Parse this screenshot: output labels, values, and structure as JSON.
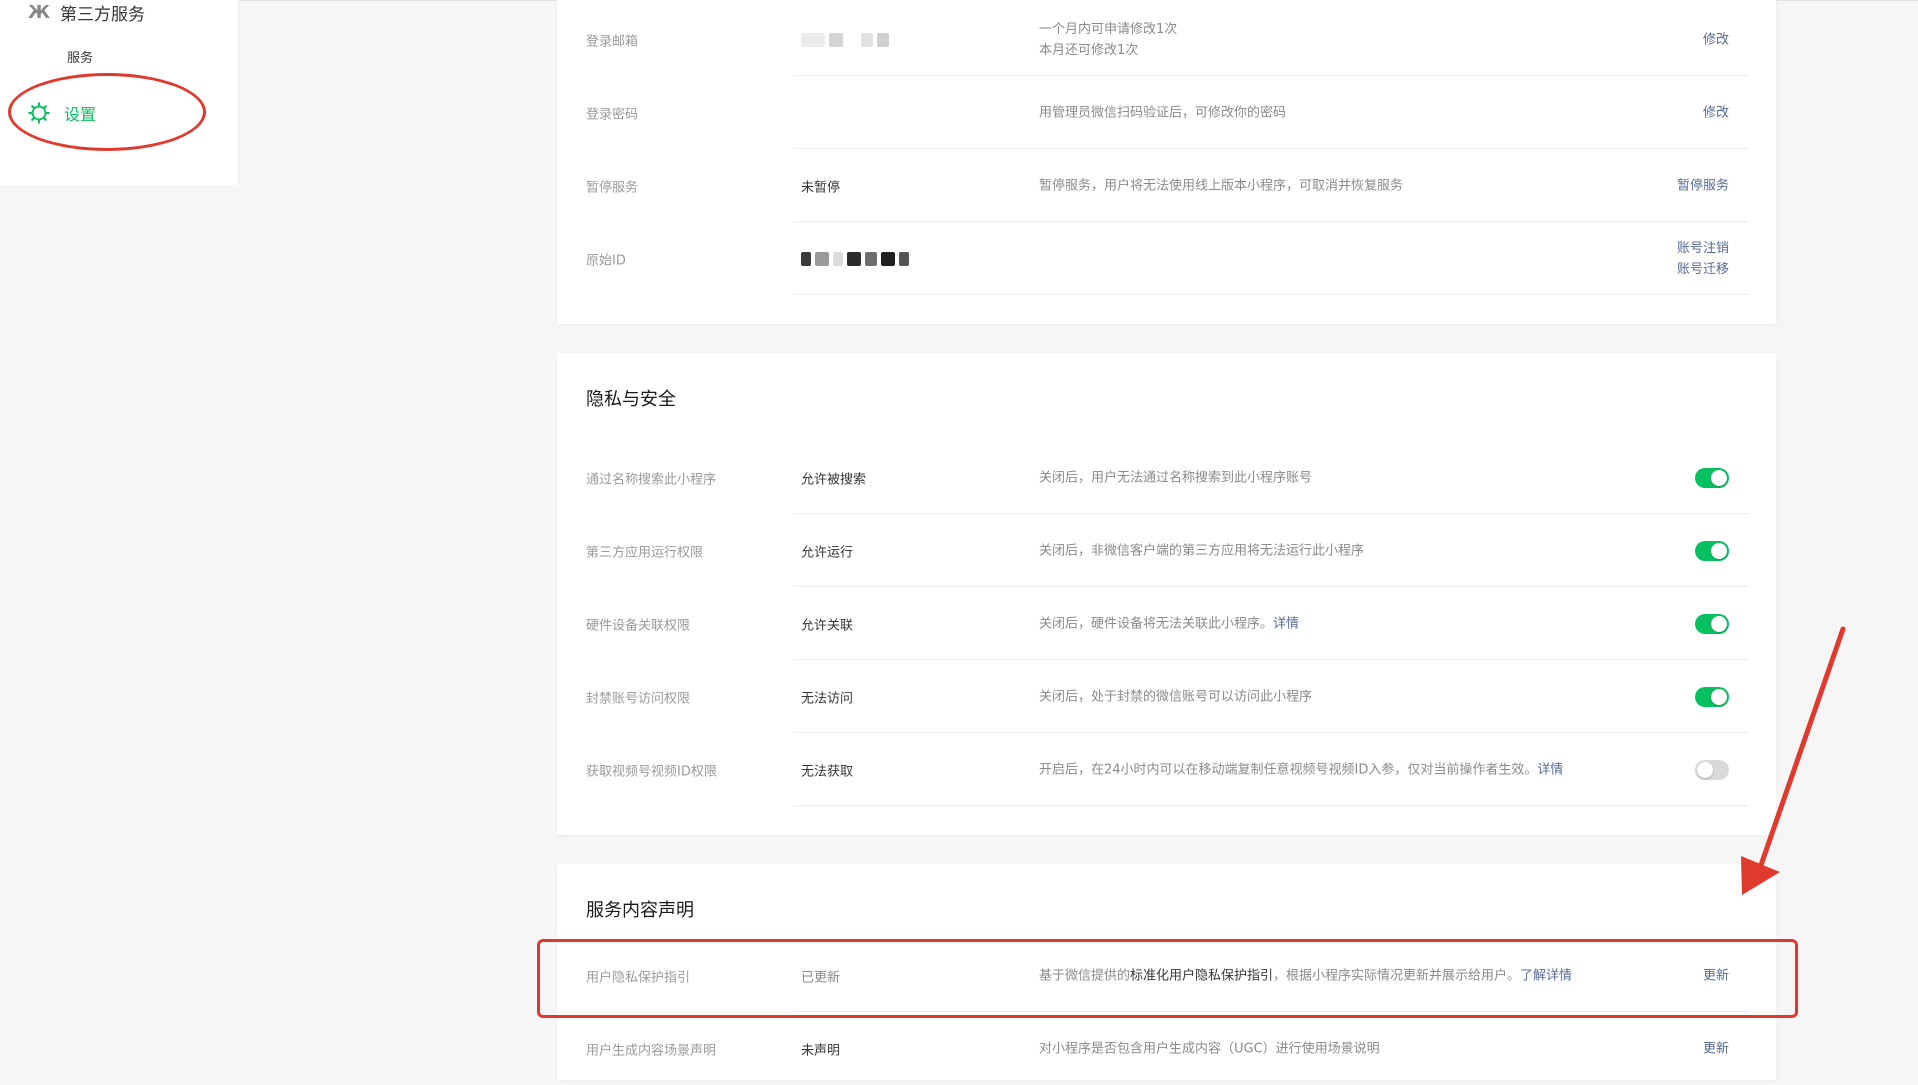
{
  "sidebar": {
    "group_label": "第三方服务",
    "sub_item": "服务",
    "settings_label": "设置"
  },
  "account": {
    "rows": [
      {
        "label": "登录邮箱",
        "value": "",
        "desc": [
          "一个月内可申请修改1次",
          "本月还可修改1次"
        ],
        "actions": [
          "修改"
        ]
      },
      {
        "label": "登录密码",
        "value": "",
        "desc": [
          "用管理员微信扫码验证后，可修改你的密码"
        ],
        "actions": [
          "修改"
        ]
      },
      {
        "label": "暂停服务",
        "value": "未暂停",
        "desc": [
          "暂停服务，用户将无法使用线上版本小程序，可取消并恢复服务"
        ],
        "actions": [
          "暂停服务"
        ]
      },
      {
        "label": "原始ID",
        "value": "",
        "desc": [],
        "actions": [
          "账号注销",
          "账号迁移"
        ]
      }
    ]
  },
  "privacy": {
    "title": "隐私与安全",
    "rows": [
      {
        "label": "通过名称搜索此小程序",
        "value": "允许被搜索",
        "desc": "关闭后，用户无法通过名称搜索到此小程序账号",
        "link": "",
        "enabled": true
      },
      {
        "label": "第三方应用运行权限",
        "value": "允许运行",
        "desc": "关闭后，非微信客户端的第三方应用将无法运行此小程序",
        "link": "",
        "enabled": true
      },
      {
        "label": "硬件设备关联权限",
        "value": "允许关联",
        "desc": "关闭后，硬件设备将无法关联此小程序。",
        "link": "详情",
        "enabled": true
      },
      {
        "label": "封禁账号访问权限",
        "value": "无法访问",
        "desc": "关闭后，处于封禁的微信账号可以访问此小程序",
        "link": "",
        "enabled": true
      },
      {
        "label": "获取视频号视频ID权限",
        "value": "无法获取",
        "desc": "开启后，在24小时内可以在移动端复制任意视频号视频ID入参，仅对当前操作者生效。",
        "link": "详情",
        "enabled": false
      }
    ]
  },
  "service_content": {
    "title": "服务内容声明",
    "rows": [
      {
        "label": "用户隐私保护指引",
        "value": "已更新",
        "desc_pre": "基于微信提供的",
        "desc_em": "标准化用户隐私保护指引",
        "desc_post": "，根据小程序实际情况更新并展示给用户。",
        "link": "了解详情",
        "action": "更新"
      },
      {
        "label": "用户生成内容场景声明",
        "value": "未声明",
        "desc_pre": "对小程序是否包含用户生成内容（UGC）进行使用场景说明",
        "desc_em": "",
        "desc_post": "",
        "link": "",
        "action": "更新"
      }
    ]
  },
  "colors": {
    "accent_green": "#07c160",
    "link_blue": "#576b95",
    "annotation_red": "#e03a2e"
  },
  "icons": [
    "app-logo-icon",
    "gear-icon",
    "arrow-annotation"
  ]
}
